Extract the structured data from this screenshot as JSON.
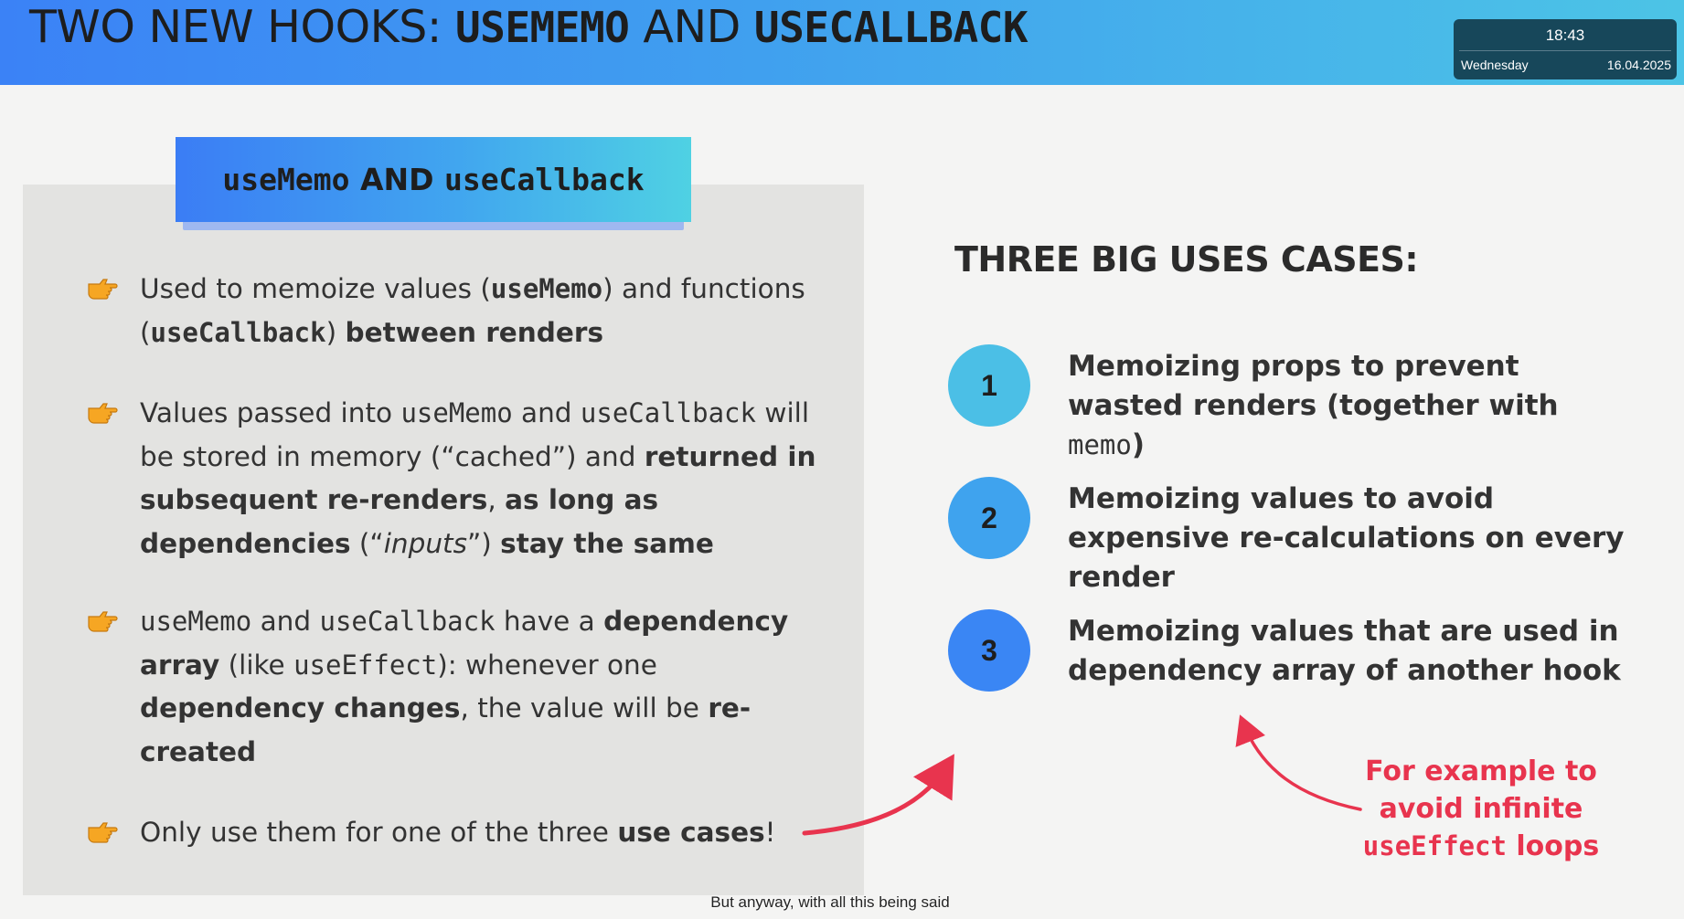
{
  "header": {
    "title_prefix": "TWO NEW HOOKS: ",
    "title_hook1": "USEMEMO",
    "title_and": " AND ",
    "title_hook2": "USECALLBACK"
  },
  "clock": {
    "time": "18:43",
    "day": "Wednesday",
    "date": "16.04.2025"
  },
  "badge": {
    "hook1": "useMemo",
    "and": " AND ",
    "hook2": "useCallback"
  },
  "bullets": {
    "b1": {
      "t1": "Used to memoize values (",
      "c1": "useMemo",
      "t2": ") and functions (",
      "c2": "useCallback",
      "t3": ") ",
      "bold1": "between renders"
    },
    "b2": {
      "t1": "Values passed into ",
      "c1": "useMemo",
      "t2": " and ",
      "c2": "useCallback",
      "t3": " will be stored in memory (“cached”) and ",
      "bold1": "returned in subsequent re-renders",
      "t4": ", ",
      "bold2": "as long as dependencies",
      "t5": " (“",
      "italic1": "inputs",
      "t6": "”) ",
      "bold3": "stay the same"
    },
    "b3": {
      "c1": "useMemo",
      "t1": " and ",
      "c2": "useCallback",
      "t2": " have a ",
      "bold1": "dependency array",
      "t3": " (like ",
      "c3": "useEffect",
      "t4": "): whenever one ",
      "bold2": "dependency changes",
      "t5": ", the value will be ",
      "bold3": "re-created"
    },
    "b4": {
      "t1": "Only use them for one of the three ",
      "bold1": "use cases",
      "t2": "!"
    }
  },
  "uses": {
    "title": "THREE BIG USES CASES:",
    "items": [
      {
        "number": "1",
        "text1": "Memoizing props to prevent wasted renders (together with ",
        "code": "memo",
        "text2": ")",
        "color": "#4bbfe6"
      },
      {
        "number": "2",
        "text1": "Memoizing values to avoid expensive re-calculations on every render",
        "color": "#3fa3ee"
      },
      {
        "number": "3",
        "text1": "Memoizing values that are used in dependency array of another hook",
        "color": "#3a86f4"
      }
    ]
  },
  "note": {
    "line1": "For example to avoid infinite",
    "code": "useEffect",
    "line2": " loops"
  },
  "subtitle": "But anyway, with all this being said",
  "colors": {
    "accent_red": "#e8344e",
    "header_start": "#3b82f6",
    "header_end": "#4cc4e6",
    "bullet_icon": "#f5a623"
  },
  "icons": {
    "bullet": "pointing-hand-icon"
  }
}
